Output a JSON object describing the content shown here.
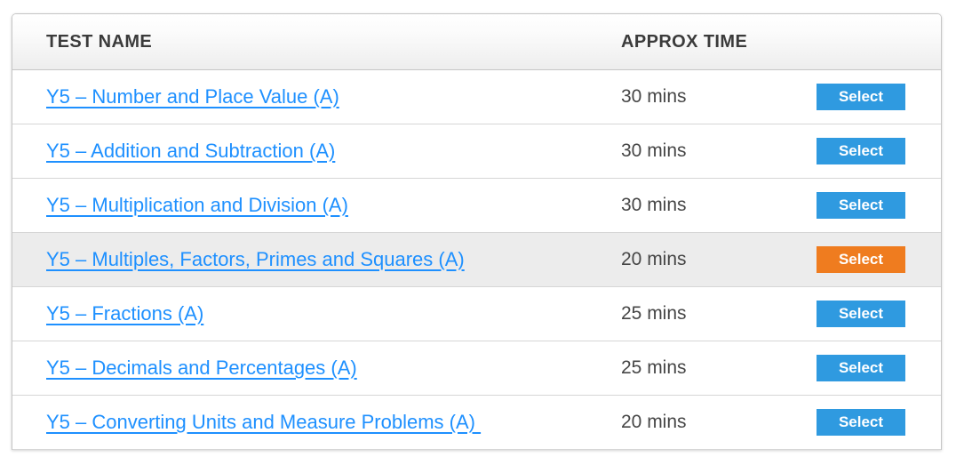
{
  "table": {
    "headers": {
      "name": "TEST NAME",
      "time": "APPROX TIME",
      "action": ""
    },
    "colors": {
      "link": "#1e90ff",
      "button_default": "#2f9ae0",
      "button_selected": "#ef7c1f",
      "row_highlight": "#ececec",
      "header_text": "#3b3b3b",
      "time_text": "#464646",
      "border": "#c6c6c6",
      "row_divider": "#d6d6d6"
    },
    "rows": [
      {
        "name": "Y5 – Number and Place Value (A)",
        "time": "30 mins",
        "button_label": "Select",
        "button_state": "default",
        "highlighted": false
      },
      {
        "name": "Y5 – Addition and Subtraction (A)",
        "time": "30 mins",
        "button_label": "Select",
        "button_state": "default",
        "highlighted": false
      },
      {
        "name": "Y5 – Multiplication and Division (A)",
        "time": "30 mins",
        "button_label": "Select",
        "button_state": "default",
        "highlighted": false
      },
      {
        "name": "Y5 – Multiples, Factors, Primes and Squares (A)",
        "time": "20 mins",
        "button_label": "Select",
        "button_state": "selected",
        "highlighted": true
      },
      {
        "name": "Y5 – Fractions (A)",
        "time": "25 mins",
        "button_label": "Select",
        "button_state": "default",
        "highlighted": false
      },
      {
        "name": "Y5 – Decimals and Percentages (A)",
        "time": "25 mins",
        "button_label": "Select",
        "button_state": "default",
        "highlighted": false
      },
      {
        "name": "Y5 – Converting Units and Measure Problems (A) ",
        "time": "20 mins",
        "button_label": "Select",
        "button_state": "default",
        "highlighted": false
      }
    ]
  }
}
